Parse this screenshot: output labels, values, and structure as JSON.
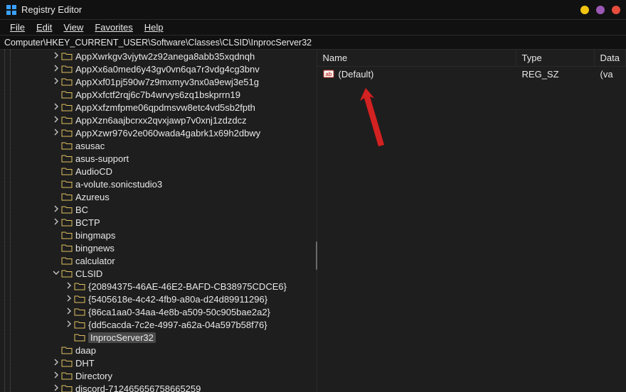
{
  "titlebar": {
    "title": "Registry Editor",
    "dots": [
      "#f1c40f",
      "#9b59b6",
      "#e74c3c"
    ]
  },
  "menu": {
    "file": "File",
    "edit": "Edit",
    "view": "View",
    "favorites": "Favorites",
    "help": "Help"
  },
  "address": "Computer\\HKEY_CURRENT_USER\\Software\\Classes\\CLSID\\InprocServer32",
  "tree": {
    "items": [
      {
        "indent": 0,
        "exp": ">",
        "label": "AppXwrkgv3vjytw2z92anega8abb35xqdnqh"
      },
      {
        "indent": 0,
        "exp": ">",
        "label": "AppXx6a0med6y43gv0vn6qa7r3vdg4cg3bnv"
      },
      {
        "indent": 0,
        "exp": ">",
        "label": "AppXxf01pj590w7z9mxmyv3nx0a9ewj3e51g"
      },
      {
        "indent": 0,
        "exp": "",
        "label": "AppXxfctf2rqj6c7b4wrvys6zq1bskprrn19"
      },
      {
        "indent": 0,
        "exp": ">",
        "label": "AppXxfzmfpme06qpdmsvw8etc4vd5sb2fpth"
      },
      {
        "indent": 0,
        "exp": ">",
        "label": "AppXzn6aajbcrxx2qvxjawp7v0xnj1zdzdcz"
      },
      {
        "indent": 0,
        "exp": ">",
        "label": "AppXzwr976v2e060wada4gabrk1x69h2dbwy"
      },
      {
        "indent": 0,
        "exp": "",
        "label": "asusac"
      },
      {
        "indent": 0,
        "exp": "",
        "label": "asus-support"
      },
      {
        "indent": 0,
        "exp": "",
        "label": "AudioCD"
      },
      {
        "indent": 0,
        "exp": "",
        "label": "a-volute.sonicstudio3"
      },
      {
        "indent": 0,
        "exp": "",
        "label": "Azureus"
      },
      {
        "indent": 0,
        "exp": ">",
        "label": "BC"
      },
      {
        "indent": 0,
        "exp": ">",
        "label": "BCTP"
      },
      {
        "indent": 0,
        "exp": "",
        "label": "bingmaps"
      },
      {
        "indent": 0,
        "exp": "",
        "label": "bingnews"
      },
      {
        "indent": 0,
        "exp": "",
        "label": "calculator"
      },
      {
        "indent": 0,
        "exp": "v",
        "label": "CLSID"
      },
      {
        "indent": 1,
        "exp": ">",
        "label": "{20894375-46AE-46E2-BAFD-CB38975CDCE6}"
      },
      {
        "indent": 1,
        "exp": ">",
        "label": "{5405618e-4c42-4fb9-a80a-d24d89911296}"
      },
      {
        "indent": 1,
        "exp": ">",
        "label": "{86ca1aa0-34aa-4e8b-a509-50c905bae2a2}"
      },
      {
        "indent": 1,
        "exp": ">",
        "label": "{dd5cacda-7c2e-4997-a62a-04a597b58f76}"
      },
      {
        "indent": 1,
        "exp": "",
        "label": "InprocServer32",
        "selected": true
      },
      {
        "indent": 0,
        "exp": "",
        "label": "daap"
      },
      {
        "indent": 0,
        "exp": ">",
        "label": "DHT"
      },
      {
        "indent": 0,
        "exp": ">",
        "label": "Directory"
      },
      {
        "indent": 0,
        "exp": ">",
        "label": "discord-712465656758665259"
      }
    ]
  },
  "values": {
    "headers": {
      "name": "Name",
      "type": "Type",
      "data": "Data"
    },
    "rows": [
      {
        "name": "(Default)",
        "type": "REG_SZ",
        "data": "(va"
      }
    ]
  }
}
